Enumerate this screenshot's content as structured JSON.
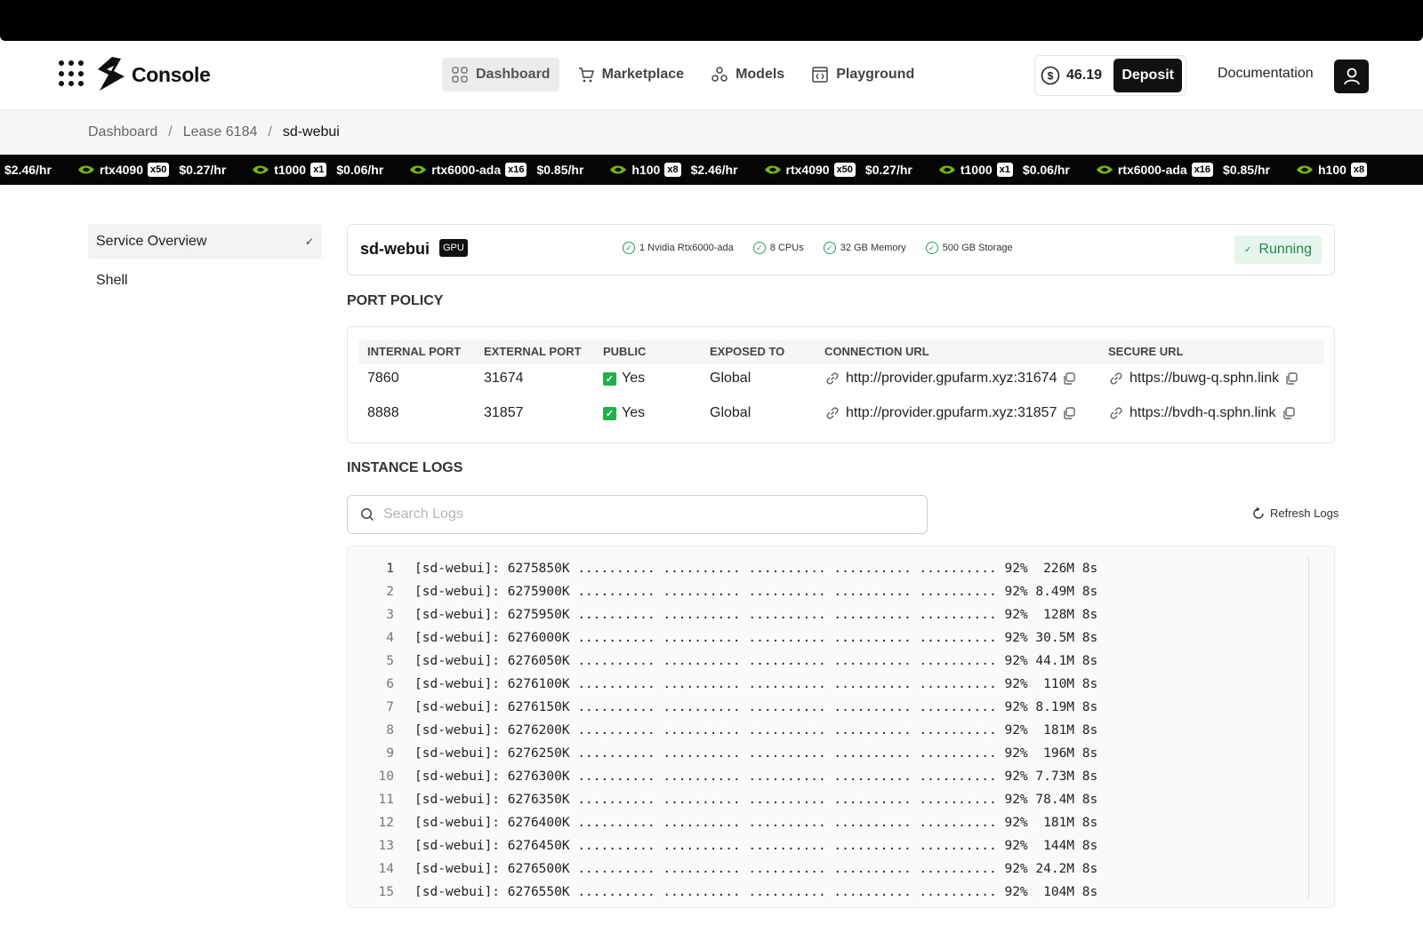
{
  "header": {
    "logo_text": "Console",
    "nav": [
      {
        "label": "Dashboard",
        "icon": "grid-icon",
        "active": true
      },
      {
        "label": "Marketplace",
        "icon": "cart-icon",
        "active": false
      },
      {
        "label": "Models",
        "icon": "models-icon",
        "active": false
      },
      {
        "label": "Playground",
        "icon": "code-window-icon",
        "active": false
      }
    ],
    "balance": "46.19",
    "deposit_label": "Deposit",
    "documentation_label": "Documentation"
  },
  "breadcrumb": [
    "Dashboard",
    "Lease 6184",
    "sd-webui"
  ],
  "ticker": {
    "leading_price": "$2.46/hr",
    "items": [
      {
        "gpu": "rtx4090",
        "mult": "x50",
        "price": "$0.27/hr"
      },
      {
        "gpu": "t1000",
        "mult": "x1",
        "price": "$0.06/hr"
      },
      {
        "gpu": "rtx6000-ada",
        "mult": "x16",
        "price": "$0.85/hr"
      },
      {
        "gpu": "h100",
        "mult": "x8",
        "price": "$2.46/hr"
      },
      {
        "gpu": "rtx4090",
        "mult": "x50",
        "price": "$0.27/hr"
      },
      {
        "gpu": "t1000",
        "mult": "x1",
        "price": "$0.06/hr"
      },
      {
        "gpu": "rtx6000-ada",
        "mult": "x16",
        "price": "$0.85/hr"
      },
      {
        "gpu": "h100",
        "mult": "x8",
        "price": ""
      }
    ]
  },
  "sidebar": {
    "items": [
      {
        "label": "Service Overview",
        "active": true
      },
      {
        "label": "Shell",
        "active": false
      }
    ]
  },
  "service": {
    "name": "sd-webui",
    "badge": "GPU",
    "specs": [
      "1 Nvidia Rtx6000-ada",
      "8 CPUs",
      "32 GB Memory",
      "500 GB Storage"
    ],
    "status": "Running",
    "status_color": "#1e8a4a"
  },
  "port_policy": {
    "title": "PORT POLICY",
    "columns": [
      "INTERNAL PORT",
      "EXTERNAL PORT",
      "PUBLIC",
      "EXPOSED TO",
      "CONNECTION URL",
      "SECURE URL"
    ],
    "rows": [
      {
        "internal": "7860",
        "external": "31674",
        "public": "Yes",
        "exposed": "Global",
        "connection_url": "http://provider.gpufarm.xyz:31674",
        "secure_url": "https://buwg-q.sphn.link"
      },
      {
        "internal": "8888",
        "external": "31857",
        "public": "Yes",
        "exposed": "Global",
        "connection_url": "http://provider.gpufarm.xyz:31857",
        "secure_url": "https://bvdh-q.sphn.link"
      }
    ]
  },
  "logs": {
    "title": "INSTANCE LOGS",
    "search_placeholder": "Search Logs",
    "refresh_label": "Refresh Logs",
    "lines": [
      "[sd-webui]: 6275850K .......... .......... .......... .......... .......... 92%  226M 8s",
      "[sd-webui]: 6275900K .......... .......... .......... .......... .......... 92% 8.49M 8s",
      "[sd-webui]: 6275950K .......... .......... .......... .......... .......... 92%  128M 8s",
      "[sd-webui]: 6276000K .......... .......... .......... .......... .......... 92% 30.5M 8s",
      "[sd-webui]: 6276050K .......... .......... .......... .......... .......... 92% 44.1M 8s",
      "[sd-webui]: 6276100K .......... .......... .......... .......... .......... 92%  110M 8s",
      "[sd-webui]: 6276150K .......... .......... .......... .......... .......... 92% 8.19M 8s",
      "[sd-webui]: 6276200K .......... .......... .......... .......... .......... 92%  181M 8s",
      "[sd-webui]: 6276250K .......... .......... .......... .......... .......... 92%  196M 8s",
      "[sd-webui]: 6276300K .......... .......... .......... .......... .......... 92% 7.73M 8s",
      "[sd-webui]: 6276350K .......... .......... .......... .......... .......... 92% 78.4M 8s",
      "[sd-webui]: 6276400K .......... .......... .......... .......... .......... 92%  181M 8s",
      "[sd-webui]: 6276450K .......... .......... .......... .......... .......... 92%  144M 8s",
      "[sd-webui]: 6276500K .......... .......... .......... .......... .......... 92% 24.2M 8s",
      "[sd-webui]: 6276550K .......... .......... .......... .......... .......... 92%  104M 8s"
    ]
  }
}
